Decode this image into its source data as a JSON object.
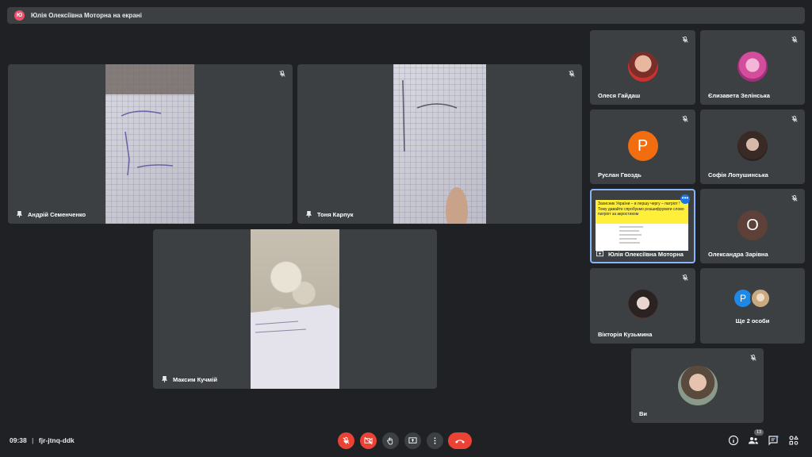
{
  "presenter_bar": {
    "avatar_letter": "Ю",
    "text": "Юлія Олексіївна Моторна на екрані"
  },
  "main_tiles": [
    {
      "name": "Андрій Семенченко"
    },
    {
      "name": "Тоня Карпук"
    },
    {
      "name": "Максим Кучмій"
    }
  ],
  "side_tiles": [
    {
      "name": "Олеся Гайдаш"
    },
    {
      "name": "Єлизавета Зелінська"
    },
    {
      "name": "Руслан Гвоздь",
      "letter": "Р",
      "color": "#f26d0f"
    },
    {
      "name": "Софія Лопушинська"
    },
    {
      "name": "Юлія Олексіївна Моторна"
    },
    {
      "name": "Олександра Зарівна",
      "letter": "О",
      "color": "#5d4037"
    },
    {
      "name": "Вікторія Кузьмина"
    },
    {
      "name": "Ще 2 особи",
      "letter": "Р",
      "color": "#1e88e5"
    },
    {
      "name": "Ви"
    }
  ],
  "shared_screen": {
    "text": "Захисник України – в першу чергу – патріот ! Тому давайте спробуємо розшифрувати слово патріот за акростихом"
  },
  "bottom": {
    "time": "09:38",
    "separator": "|",
    "meeting_code": "fjr-jtnq-ddk",
    "people_count": "13"
  }
}
